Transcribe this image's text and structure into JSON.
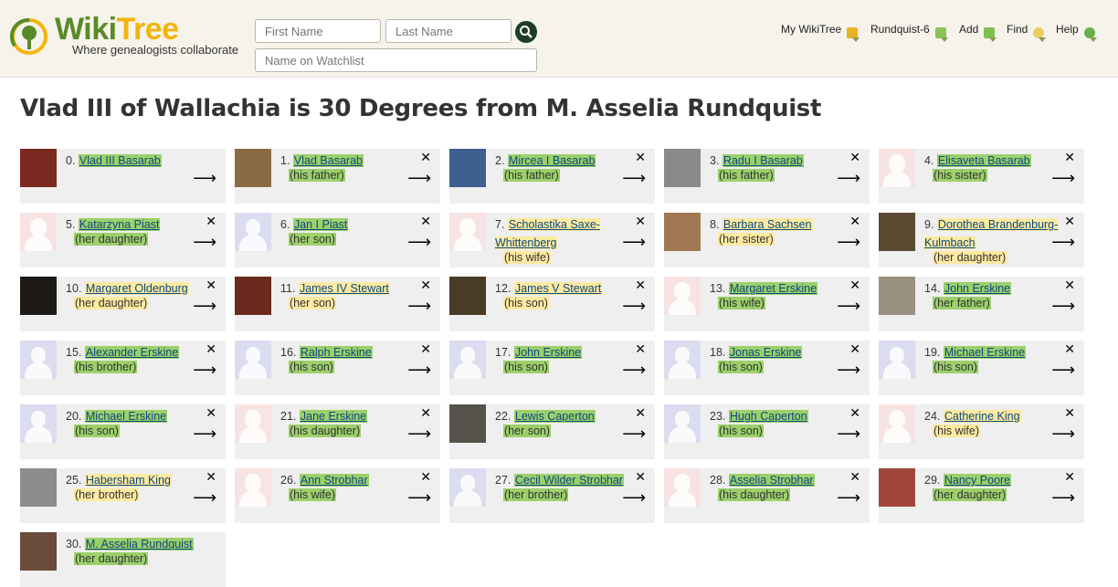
{
  "header": {
    "logo_wiki": "Wiki",
    "logo_tree": "Tree",
    "tagline": "Where genealogists collaborate",
    "first_name_placeholder": "First Name",
    "last_name_placeholder": "Last Name",
    "watchlist_placeholder": "Name on Watchlist",
    "nav": [
      "My WikiTree",
      "Rundquist-6",
      "Add",
      "Find",
      "Help"
    ]
  },
  "title": "Vlad III of Wallachia is 30 Degrees from M. Asselia Rundquist",
  "chain": [
    {
      "n": "0.",
      "name": "Vlad III Basarab",
      "rel": "",
      "hl": "green",
      "thumb": "photo",
      "color": "#7b2a20",
      "close": false
    },
    {
      "n": "1.",
      "name": "Vlad Basarab",
      "rel": "(his father)",
      "hl": "green",
      "thumb": "photo",
      "color": "#8a6a45",
      "close": true
    },
    {
      "n": "2.",
      "name": "Mircea I Basarab",
      "rel": "(his father)",
      "hl": "green",
      "thumb": "photo",
      "color": "#3f5f8f",
      "close": true
    },
    {
      "n": "3.",
      "name": "Radu I Basarab",
      "rel": "(his father)",
      "hl": "green",
      "thumb": "photo",
      "color": "#8a8a8a",
      "close": true
    },
    {
      "n": "4.",
      "name": "Elisaveta Basarab",
      "rel": "(his sister)",
      "hl": "green",
      "thumb": "f",
      "color": "",
      "close": true
    },
    {
      "n": "5.",
      "name": "Katarzyna Piast",
      "rel": "(her daughter)",
      "hl": "green",
      "thumb": "f",
      "color": "",
      "close": true
    },
    {
      "n": "6.",
      "name": "Jan I Piast",
      "rel": "(her son)",
      "hl": "green",
      "thumb": "m",
      "color": "",
      "close": true
    },
    {
      "n": "7.",
      "name": "Scholastika Saxe-Whittenberg",
      "rel": "(his wife)",
      "hl": "yellow",
      "thumb": "f",
      "color": "",
      "close": true
    },
    {
      "n": "8.",
      "name": "Barbara Sachsen",
      "rel": "(her sister)",
      "hl": "yellow",
      "thumb": "photo",
      "color": "#a07850",
      "close": true
    },
    {
      "n": "9.",
      "name": "Dorothea Brandenburg-Kulmbach",
      "rel": "(her daughter)",
      "hl": "yellow",
      "thumb": "photo",
      "color": "#5b4a32",
      "close": true
    },
    {
      "n": "10.",
      "name": "Margaret Oldenburg",
      "rel": "(her daughter)",
      "hl": "yellow",
      "thumb": "photo",
      "color": "#1e1a16",
      "close": true
    },
    {
      "n": "11.",
      "name": "James IV Stewart",
      "rel": "(her son)",
      "hl": "yellow",
      "thumb": "photo",
      "color": "#6a2a1e",
      "close": true
    },
    {
      "n": "12.",
      "name": "James V Stewart",
      "rel": "(his son)",
      "hl": "yellow",
      "thumb": "photo",
      "color": "#4a3a28",
      "close": true
    },
    {
      "n": "13.",
      "name": "Margaret Erskine",
      "rel": "(his wife)",
      "hl": "green",
      "thumb": "f",
      "color": "",
      "close": true
    },
    {
      "n": "14.",
      "name": "John Erskine",
      "rel": "(her father)",
      "hl": "green",
      "thumb": "photo",
      "color": "#9a9080",
      "close": true
    },
    {
      "n": "15.",
      "name": "Alexander Erskine",
      "rel": "(his brother)",
      "hl": "green",
      "thumb": "m",
      "color": "",
      "close": true
    },
    {
      "n": "16.",
      "name": "Ralph Erskine",
      "rel": "(his son)",
      "hl": "green",
      "thumb": "m",
      "color": "",
      "close": true
    },
    {
      "n": "17.",
      "name": "John Erskine",
      "rel": "(his son)",
      "hl": "green",
      "thumb": "m",
      "color": "",
      "close": true
    },
    {
      "n": "18.",
      "name": "Jonas Erskine",
      "rel": "(his son)",
      "hl": "green",
      "thumb": "m",
      "color": "",
      "close": true
    },
    {
      "n": "19.",
      "name": "Michael Erskine",
      "rel": "(his son)",
      "hl": "green",
      "thumb": "m",
      "color": "",
      "close": true
    },
    {
      "n": "20.",
      "name": "Michael Erskine",
      "rel": "(his son)",
      "hl": "green",
      "thumb": "m",
      "color": "",
      "close": true
    },
    {
      "n": "21.",
      "name": "Jane Erskine",
      "rel": "(his daughter)",
      "hl": "green",
      "thumb": "f",
      "color": "",
      "close": true
    },
    {
      "n": "22.",
      "name": "Lewis Caperton",
      "rel": "(her son)",
      "hl": "green",
      "thumb": "photo",
      "color": "#55524c",
      "close": true
    },
    {
      "n": "23.",
      "name": "Hugh Caperton",
      "rel": "(his son)",
      "hl": "green",
      "thumb": "m",
      "color": "",
      "close": true
    },
    {
      "n": "24.",
      "name": "Catherine King",
      "rel": "(his wife)",
      "hl": "yellow",
      "thumb": "f",
      "color": "",
      "close": true
    },
    {
      "n": "25.",
      "name": "Habersham King",
      "rel": "(her brother)",
      "hl": "yellow",
      "thumb": "photo",
      "color": "#8c8c8c",
      "close": true
    },
    {
      "n": "26.",
      "name": "Ann Strobhar",
      "rel": "(his wife)",
      "hl": "green",
      "thumb": "f",
      "color": "",
      "close": true
    },
    {
      "n": "27.",
      "name": "Cecil Wilder Strobhar",
      "rel": "(her brother)",
      "hl": "green",
      "thumb": "m",
      "color": "",
      "close": true
    },
    {
      "n": "28.",
      "name": "Asselia Strobhar",
      "rel": "(his daughter)",
      "hl": "green",
      "thumb": "f",
      "color": "",
      "close": true
    },
    {
      "n": "29.",
      "name": "Nancy Poore",
      "rel": "(her daughter)",
      "hl": "green",
      "thumb": "photo",
      "color": "#a0463c",
      "close": true
    },
    {
      "n": "30.",
      "name": "M. Asselia Rundquist",
      "rel": "(her daughter)",
      "hl": "green",
      "thumb": "photo",
      "color": "#6a4a3a",
      "close": false
    }
  ],
  "colors": {
    "green": "#9cd06b",
    "yellow": "#fde9a0",
    "link": "#0b4a80"
  }
}
